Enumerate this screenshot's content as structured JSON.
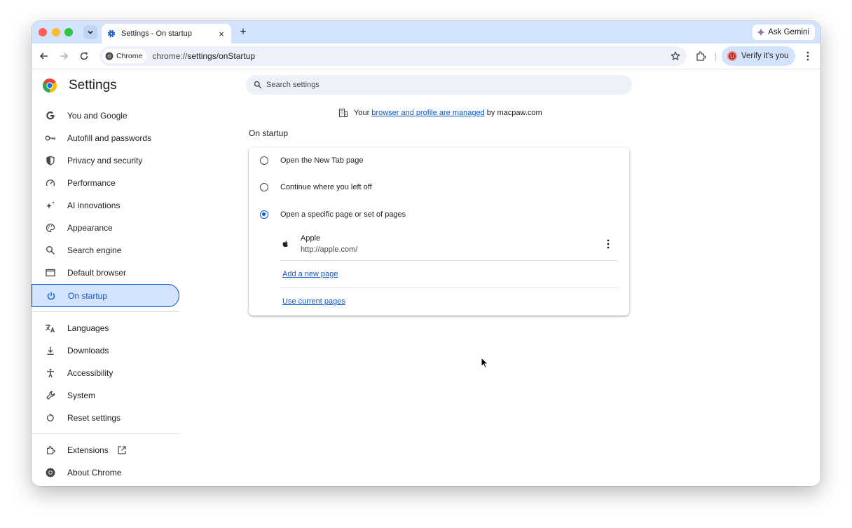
{
  "tab": {
    "title": "Settings - On startup",
    "close_label": "×",
    "new_tab_label": "+"
  },
  "gemini": {
    "label": "Ask Gemini"
  },
  "omnibox": {
    "chip_label": "Chrome",
    "url_prefix": "chrome://",
    "url_path": "settings/onStartup"
  },
  "profile": {
    "verify_label": "Verify it's you",
    "avatar_letter": "U"
  },
  "settings": {
    "title": "Settings",
    "search_placeholder": "Search settings"
  },
  "sidebar": {
    "items": [
      {
        "label": "You and Google",
        "icon": "google-icon"
      },
      {
        "label": "Autofill and passwords",
        "icon": "key-icon"
      },
      {
        "label": "Privacy and security",
        "icon": "shield-icon"
      },
      {
        "label": "Performance",
        "icon": "speedometer-icon"
      },
      {
        "label": "AI innovations",
        "icon": "sparkle-icon"
      },
      {
        "label": "Appearance",
        "icon": "palette-icon"
      },
      {
        "label": "Search engine",
        "icon": "search-icon"
      },
      {
        "label": "Default browser",
        "icon": "browser-window-icon"
      },
      {
        "label": "On startup",
        "icon": "power-icon"
      }
    ],
    "items2": [
      {
        "label": "Languages",
        "icon": "translate-icon"
      },
      {
        "label": "Downloads",
        "icon": "download-icon"
      },
      {
        "label": "Accessibility",
        "icon": "accessibility-icon"
      },
      {
        "label": "System",
        "icon": "wrench-icon"
      },
      {
        "label": "Reset settings",
        "icon": "reset-icon"
      }
    ],
    "items3": [
      {
        "label": "Extensions",
        "icon": "puzzle-icon"
      },
      {
        "label": "About Chrome",
        "icon": "chrome-icon"
      }
    ]
  },
  "managed": {
    "prefix": "Your",
    "link": "browser and profile are managed",
    "suffix": "by macpaw.com"
  },
  "startup": {
    "section_title": "On startup",
    "options": [
      {
        "label": "Open the New Tab page",
        "checked": false
      },
      {
        "label": "Continue where you left off",
        "checked": false
      },
      {
        "label": "Open a specific page or set of pages",
        "checked": true
      }
    ],
    "pages": [
      {
        "name": "Apple",
        "url": "http://apple.com/"
      }
    ],
    "add_page_label": "Add a new page",
    "use_current_label": "Use current pages"
  },
  "colors": {
    "accent": "#0b57d0",
    "tabstrip": "#d3e3fd",
    "omnibox_bg": "#edf2fa"
  }
}
